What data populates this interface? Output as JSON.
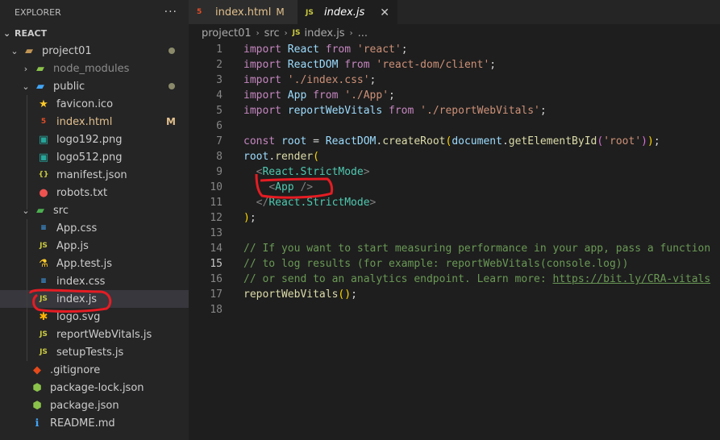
{
  "explorer": {
    "title": "EXPLORER",
    "more": "···",
    "section": "REACT",
    "tree": [
      {
        "label": "project01",
        "level": 1,
        "icon": "folder-open",
        "chevron": "down",
        "dot": true
      },
      {
        "label": "node_modules",
        "level": 2,
        "icon": "node-folder",
        "chevron": "right",
        "dim": true
      },
      {
        "label": "public",
        "level": 2,
        "icon": "public-folder",
        "chevron": "down",
        "dot": true
      },
      {
        "label": "favicon.ico",
        "level": 3,
        "icon": "star"
      },
      {
        "label": "index.html",
        "level": 3,
        "icon": "html5",
        "badge": "M",
        "modified": true
      },
      {
        "label": "logo192.png",
        "level": 3,
        "icon": "image"
      },
      {
        "label": "logo512.png",
        "level": 3,
        "icon": "image"
      },
      {
        "label": "manifest.json",
        "level": 3,
        "icon": "json-braces"
      },
      {
        "label": "robots.txt",
        "level": 3,
        "icon": "robot"
      },
      {
        "label": "src",
        "level": 2,
        "icon": "src-folder",
        "chevron": "down"
      },
      {
        "label": "App.css",
        "level": 3,
        "icon": "css"
      },
      {
        "label": "App.js",
        "level": 3,
        "icon": "js"
      },
      {
        "label": "App.test.js",
        "level": 3,
        "icon": "test-flask"
      },
      {
        "label": "index.css",
        "level": 3,
        "icon": "css"
      },
      {
        "label": "index.js",
        "level": 3,
        "icon": "js",
        "selected": true
      },
      {
        "label": "logo.svg",
        "level": 3,
        "icon": "svg-asterisk"
      },
      {
        "label": "reportWebVitals.js",
        "level": 3,
        "icon": "js"
      },
      {
        "label": "setupTests.js",
        "level": 3,
        "icon": "js"
      },
      {
        "label": ".gitignore",
        "level": 2,
        "icon": "git"
      },
      {
        "label": "package-lock.json",
        "level": 2,
        "icon": "npm"
      },
      {
        "label": "package.json",
        "level": 2,
        "icon": "npm"
      },
      {
        "label": "README.md",
        "level": 2,
        "icon": "info"
      }
    ]
  },
  "tabs": [
    {
      "label": "index.html",
      "icon": "html5",
      "modified": "M",
      "active": false
    },
    {
      "label": "index.js",
      "icon": "js",
      "close": "✕",
      "active": true
    }
  ],
  "breadcrumb": [
    "project01",
    "src",
    "index.js",
    "..."
  ],
  "code": [
    [
      [
        "kw",
        "import "
      ],
      [
        "id",
        "React "
      ],
      [
        "kw",
        "from "
      ],
      [
        "str",
        "'react'"
      ],
      [
        "pl",
        ";"
      ]
    ],
    [
      [
        "kw",
        "import "
      ],
      [
        "id",
        "ReactDOM "
      ],
      [
        "kw",
        "from "
      ],
      [
        "str",
        "'react-dom/client'"
      ],
      [
        "pl",
        ";"
      ]
    ],
    [
      [
        "kw",
        "import "
      ],
      [
        "str",
        "'./index.css'"
      ],
      [
        "pl",
        ";"
      ]
    ],
    [
      [
        "kw",
        "import "
      ],
      [
        "id",
        "App "
      ],
      [
        "kw",
        "from "
      ],
      [
        "str",
        "'./App'"
      ],
      [
        "pl",
        ";"
      ]
    ],
    [
      [
        "kw",
        "import "
      ],
      [
        "id",
        "reportWebVitals "
      ],
      [
        "kw",
        "from "
      ],
      [
        "str",
        "'./reportWebVitals'"
      ],
      [
        "pl",
        ";"
      ]
    ],
    [],
    [
      [
        "kw",
        "const "
      ],
      [
        "id",
        "root "
      ],
      [
        "pl",
        "= "
      ],
      [
        "id",
        "ReactDOM"
      ],
      [
        "pl",
        "."
      ],
      [
        "fn",
        "createRoot"
      ],
      [
        "p1",
        "("
      ],
      [
        "id",
        "document"
      ],
      [
        "pl",
        "."
      ],
      [
        "fn",
        "getElementById"
      ],
      [
        "p2",
        "("
      ],
      [
        "str",
        "'root'"
      ],
      [
        "p2",
        ")"
      ],
      [
        "p1",
        ")"
      ],
      [
        "pl",
        ";"
      ]
    ],
    [
      [
        "id",
        "root"
      ],
      [
        "pl",
        "."
      ],
      [
        "fn",
        "render"
      ],
      [
        "p1",
        "("
      ]
    ],
    [
      [
        "pl",
        "  "
      ],
      [
        "pun",
        "<"
      ],
      [
        "tag",
        "React.StrictMode"
      ],
      [
        "pun",
        ">"
      ]
    ],
    [
      [
        "pl",
        "    "
      ],
      [
        "pun",
        "<"
      ],
      [
        "tag",
        "App "
      ],
      [
        "pun",
        "/>"
      ]
    ],
    [
      [
        "pl",
        "  "
      ],
      [
        "pun",
        "</"
      ],
      [
        "tag",
        "React.StrictMode"
      ],
      [
        "pun",
        ">"
      ]
    ],
    [
      [
        "p1",
        ")"
      ],
      [
        "pl",
        ";"
      ]
    ],
    [],
    [
      [
        "cm",
        "// If you want to start measuring performance in your app, pass a function"
      ]
    ],
    [
      [
        "cm",
        "// to log results (for example: reportWebVitals(console.log))"
      ]
    ],
    [
      [
        "cm",
        "// or send to an analytics endpoint. Learn more: "
      ],
      [
        "lnk",
        "https://bit.ly/CRA-vitals"
      ]
    ],
    [
      [
        "fn",
        "reportWebVitals"
      ],
      [
        "p1",
        "()"
      ],
      [
        "pl",
        ";"
      ]
    ],
    []
  ],
  "current_line": 15,
  "colors": {
    "accent": "#007acc",
    "annotation": "#e51c23"
  }
}
